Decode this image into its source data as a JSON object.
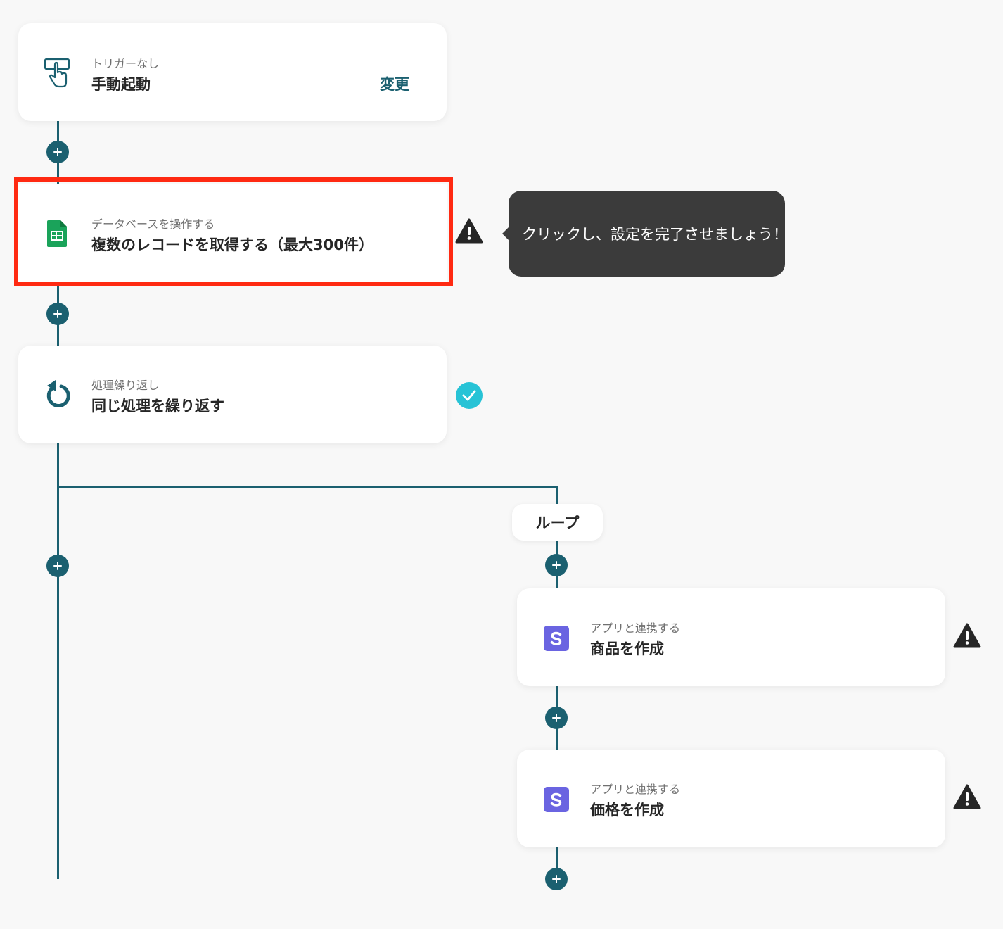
{
  "flow": {
    "trigger": {
      "subtitle": "トリガーなし",
      "title": "手動起動",
      "change_label": "変更",
      "icon": "hand-pointer-icon"
    },
    "step_database": {
      "subtitle": "データベースを操作する",
      "title": "複数のレコードを取得する（最大300件）",
      "icon": "google-sheets-icon",
      "status": "warning"
    },
    "step_loop": {
      "subtitle": "処理繰り返し",
      "title": "同じ処理を繰り返す",
      "icon": "repeat-icon",
      "status": "complete"
    },
    "loop_label": "ループ",
    "step_product": {
      "subtitle": "アプリと連携する",
      "title": "商品を作成",
      "icon": "stripe-icon",
      "status": "warning"
    },
    "step_price": {
      "subtitle": "アプリと連携する",
      "title": "価格を作成",
      "icon": "stripe-icon",
      "status": "warning"
    }
  },
  "tooltip": {
    "text": "クリックし、設定を完了させましょう！"
  },
  "colors": {
    "accent": "#1b6070",
    "highlight_border": "#ff2a12",
    "tooltip_bg": "#3b3b3b",
    "success": "#27c3d6",
    "sheets_green": "#1aa35a",
    "stripe_purple": "#6a64e1"
  }
}
